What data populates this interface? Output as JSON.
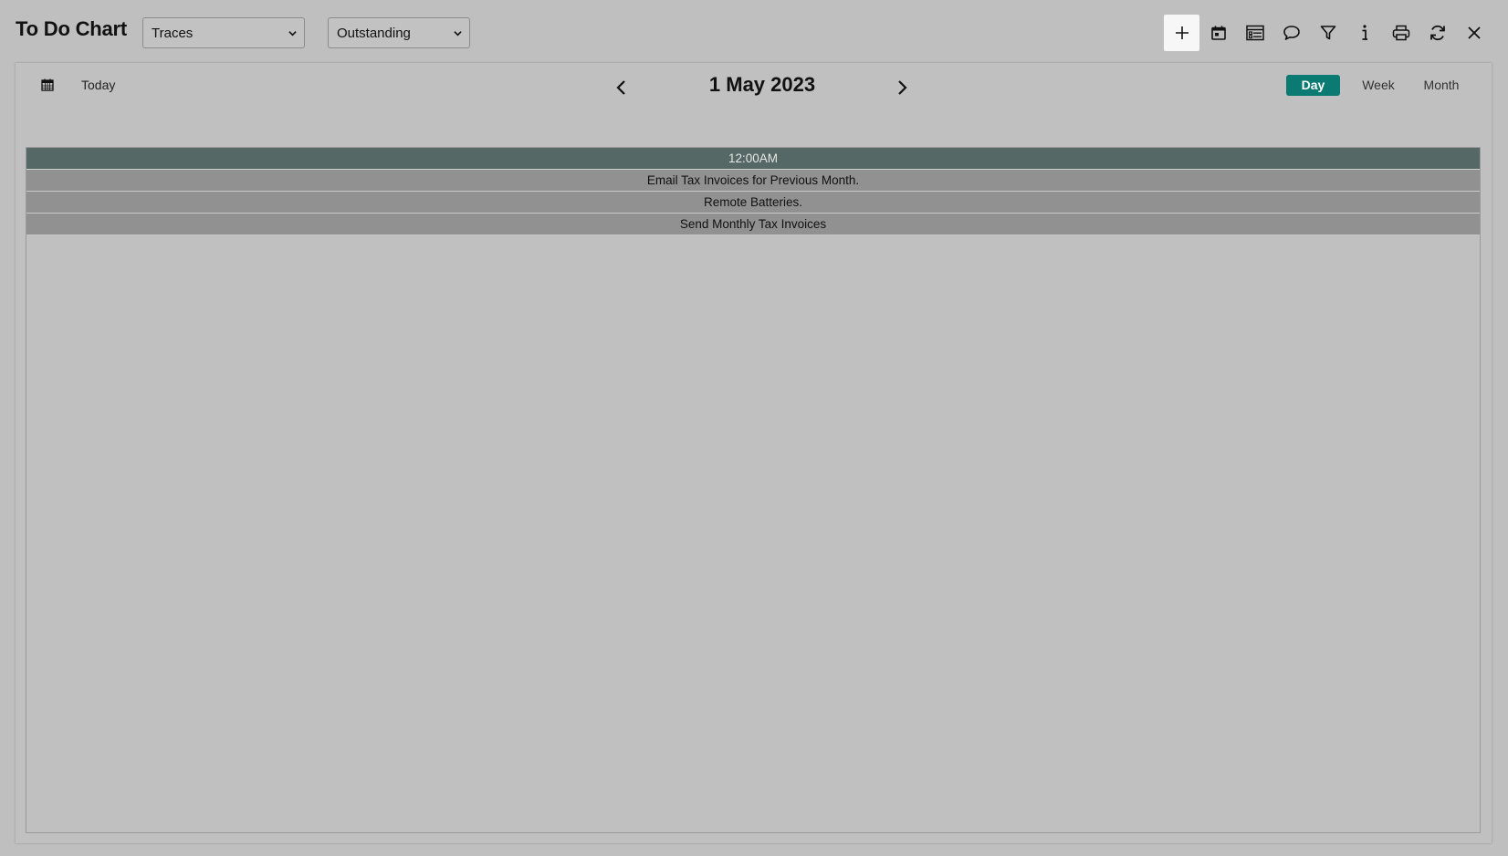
{
  "header": {
    "title": "To Do Chart",
    "type_select": {
      "value": "Traces"
    },
    "status_select": {
      "value": "Outstanding"
    },
    "toolbar": [
      {
        "name": "add-icon",
        "active": true
      },
      {
        "name": "calendar-icon"
      },
      {
        "name": "list-icon"
      },
      {
        "name": "comment-icon"
      },
      {
        "name": "filter-icon"
      },
      {
        "name": "info-icon"
      },
      {
        "name": "print-icon"
      },
      {
        "name": "refresh-icon"
      },
      {
        "name": "close-icon"
      }
    ]
  },
  "calendar": {
    "today_label": "Today",
    "date_title": "1 May 2023",
    "views": {
      "day": "Day",
      "week": "Week",
      "month": "Month"
    },
    "active_view": "Day",
    "accent_color": "#0a7a72",
    "time_slot": "12:00AM",
    "tasks": [
      "Email Tax Invoices for Previous Month.",
      "Remote Batteries.",
      "Send Monthly Tax Invoices"
    ]
  }
}
